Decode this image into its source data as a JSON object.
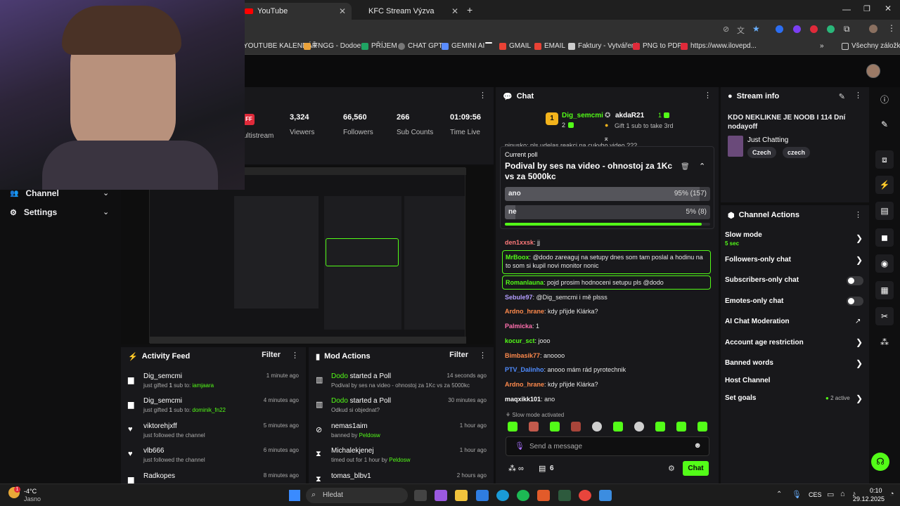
{
  "browser": {
    "tabs": [
      {
        "label": "YouTube"
      },
      {
        "label": "KFC Stream Výzva"
      }
    ],
    "bookmarks": [
      "YOUTUBE KALENDÁŘ",
      "FNGG - Dodoeu",
      "PŘÍJEM",
      "CHAT GPT",
      "GEMINI AI",
      "GMAIL",
      "EMAIL",
      "Faktury - Vytváření",
      "PNG to PDF",
      "https://www.ilovepd...",
      "Všechny záložky"
    ]
  },
  "sidebar": {
    "items": [
      {
        "label": "Channel"
      },
      {
        "label": "Settings"
      }
    ]
  },
  "stats": {
    "partial_label": "ultistream",
    "badge": "FF",
    "items": [
      {
        "value": "3,324",
        "label": "Viewers"
      },
      {
        "value": "66,560",
        "label": "Followers"
      },
      {
        "value": "266",
        "label": "Sub Counts"
      },
      {
        "value": "01:09:56",
        "label": "Time Live"
      }
    ]
  },
  "activity": {
    "title": "Activity Feed",
    "filter": "Filter",
    "items": [
      {
        "name": "Dig_semcmi",
        "pre": "just gifted ",
        "num": "1",
        "mid": " sub to: ",
        "target": "iamjaara",
        "time": "1 minute ago"
      },
      {
        "name": "Dig_semcmi",
        "pre": "just gifted ",
        "num": "1",
        "mid": " sub to: ",
        "target": "dominik_fn22",
        "time": "4 minutes ago"
      },
      {
        "name": "viktorehjxff",
        "sub": "just followed the channel",
        "time": "5 minutes ago"
      },
      {
        "name": "vlb666",
        "sub": "just followed the channel",
        "time": "6 minutes ago"
      },
      {
        "name": "Radkopes",
        "sub": "",
        "time": "8 minutes ago"
      }
    ]
  },
  "mod": {
    "title": "Mod Actions",
    "filter": "Filter",
    "items": [
      {
        "user": "Dodo",
        "action": " started a Poll",
        "sub": "Podival by ses na video - ohnostoj za 1Kc vs za 5000kc",
        "time": "14 seconds ago"
      },
      {
        "user": "Dodo",
        "action": " started a Poll",
        "sub": "Odkud si objednat?",
        "time": "30 minutes ago"
      },
      {
        "user": "nemas1aim",
        "action": "",
        "sub": "banned by ",
        "by": "Peldosw",
        "time": "1 hour ago"
      },
      {
        "user": "Michalekjenej",
        "action": "",
        "sub": "timed out for 1 hour by ",
        "by": "Peldosw",
        "time": "1 hour ago"
      },
      {
        "user": "tomas_blbv1",
        "action": "",
        "sub": "",
        "time": "2 hours ago"
      }
    ]
  },
  "chat": {
    "title": "Chat",
    "gift": {
      "gifter": "Dig_semcmi",
      "gifter_count": "2",
      "top": "akdaR21",
      "top_count": "1",
      "caption": "Gift 1 sub to take 3rd"
    },
    "poll": {
      "label": "Current poll",
      "question": "Podival by ses na video - ohnostoj za 1Kc vs za 5000kc",
      "options": [
        {
          "text": "ano",
          "result": "95% (157)",
          "fraction": 0.95
        },
        {
          "text": "ne",
          "result": "5% (8)",
          "fraction": 0.05
        }
      ],
      "remaining_fraction": 0.96
    },
    "partial_top": "pinusko: pls udelas reakci na cukyho video ???",
    "messages": [
      {
        "user": "den1xxsk",
        "text": "jj",
        "color": "#ff7a7a"
      },
      {
        "user": "MrBoox",
        "text": "@dodo zareaguj na setupy dnes som tam poslal a hodinu na to som si kupil novi monitor nonic",
        "color": "#53fc18"
      },
      {
        "user": "Romanlauna",
        "text": "pojd prosim hodnoceni setupu pls @dodo",
        "color": "#53fc18"
      },
      {
        "user": "Sebule97",
        "text": "@Dig_semcmi i mě plsss",
        "color": "#b39dff"
      },
      {
        "user": "Ardno_hrane",
        "text": "kdy přijde Klárka?",
        "color": "#ff8a4c"
      },
      {
        "user": "Palmicka",
        "text": "1",
        "color": "#ff6fae"
      },
      {
        "user": "kocur_sct",
        "text": "jooo",
        "color": "#53fc18"
      },
      {
        "user": "Bimbasik77",
        "text": "anoooo",
        "color": "#ff8a4c"
      },
      {
        "user": "PTV_Dalinho",
        "text": "anooo mám rád pyrotechnik",
        "color": "#4f8cff"
      },
      {
        "user": "Ardno_hrane",
        "text": "kdy přijde Klárka?",
        "color": "#ff8a4c"
      },
      {
        "user": "maqxikk101",
        "text": "ano",
        "color": "#ffffff"
      }
    ],
    "slow_notice": "Slow mode activated",
    "input_placeholder": "Send a message",
    "viewers_count": "6",
    "send": "Chat"
  },
  "stream_info": {
    "title": "Stream info",
    "stream_title": "KDO NEKLIKNE JE NOOB I 114 Dní nodayoff",
    "category": "Just Chatting",
    "tags": [
      "Czech",
      "czech"
    ]
  },
  "actions": {
    "title": "Channel Actions",
    "slow_mode": "Slow mode",
    "slow_mode_value": "5 sec",
    "items": [
      "Followers-only chat",
      "Subscribers-only chat",
      "Emotes-only chat",
      "AI Chat Moderation",
      "Account age restriction",
      "Banned words",
      "Host Channel",
      "Set goals"
    ],
    "goals_status": "2 active"
  },
  "taskbar": {
    "weather_temp": "-4°C",
    "weather_text": "Jasno",
    "search": "Hledat",
    "lang": "CES",
    "time": "0:10",
    "date": "29.12.2025"
  }
}
